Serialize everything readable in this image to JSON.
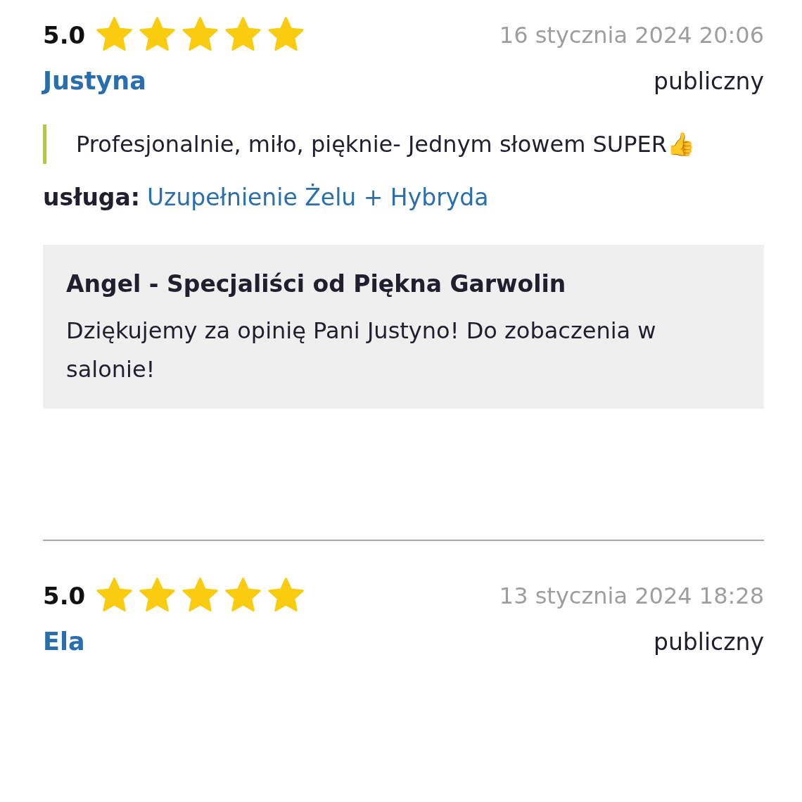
{
  "reviews": [
    {
      "rating": "5.0",
      "stars": 5,
      "date": "16 stycznia 2024 20:06",
      "author": "Justyna",
      "visibility": "publiczny",
      "comment": "Profesjonalnie, miło, pięknie- Jednym słowem SUPER👍",
      "service_label": "usługa:",
      "service": "Uzupełnienie Żelu + Hybryda",
      "reply": {
        "business": "Angel - Specjaliści od Piękna Garwolin",
        "text": "Dziękujemy za opinię Pani Justyno! Do zobaczenia w salonie!"
      }
    },
    {
      "rating": "5.0",
      "stars": 5,
      "date": "13 stycznia 2024 18:28",
      "author": "Ela",
      "visibility": "publiczny"
    }
  ]
}
